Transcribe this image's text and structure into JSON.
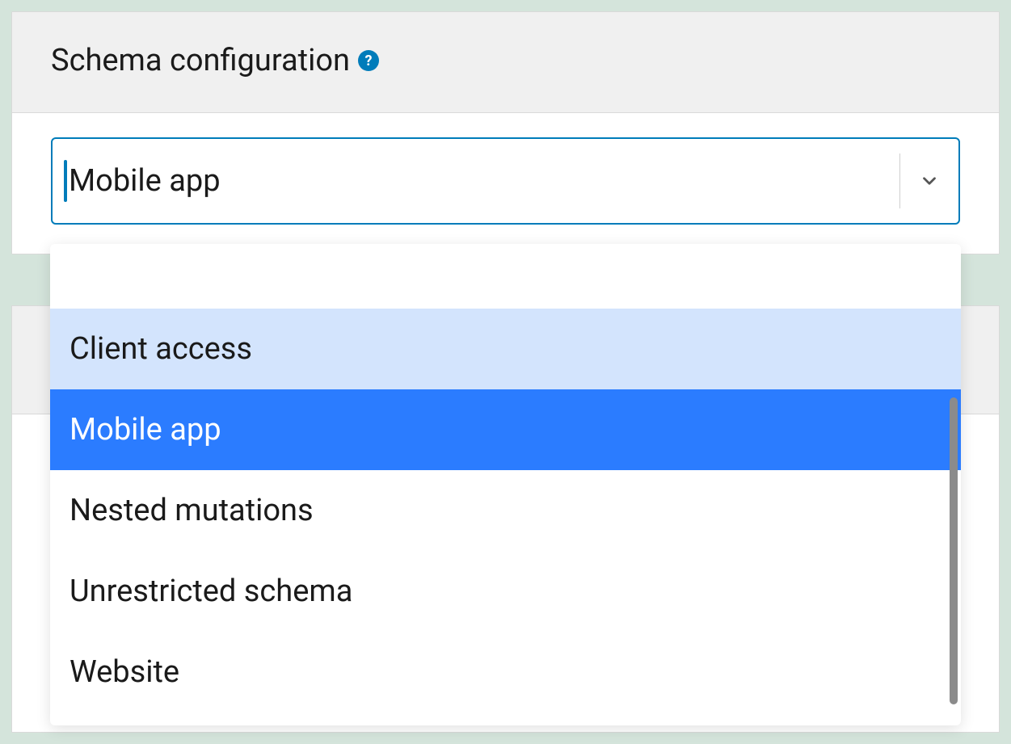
{
  "panel": {
    "title": "Schema configuration"
  },
  "select": {
    "value": "Mobile app"
  },
  "dropdown": {
    "peek_label": "None",
    "options": [
      {
        "label": "Client access",
        "state": "highlight"
      },
      {
        "label": "Mobile app",
        "state": "selected"
      },
      {
        "label": "Nested mutations",
        "state": "normal"
      },
      {
        "label": "Unrestricted schema",
        "state": "normal"
      },
      {
        "label": "Website",
        "state": "normal"
      }
    ]
  }
}
